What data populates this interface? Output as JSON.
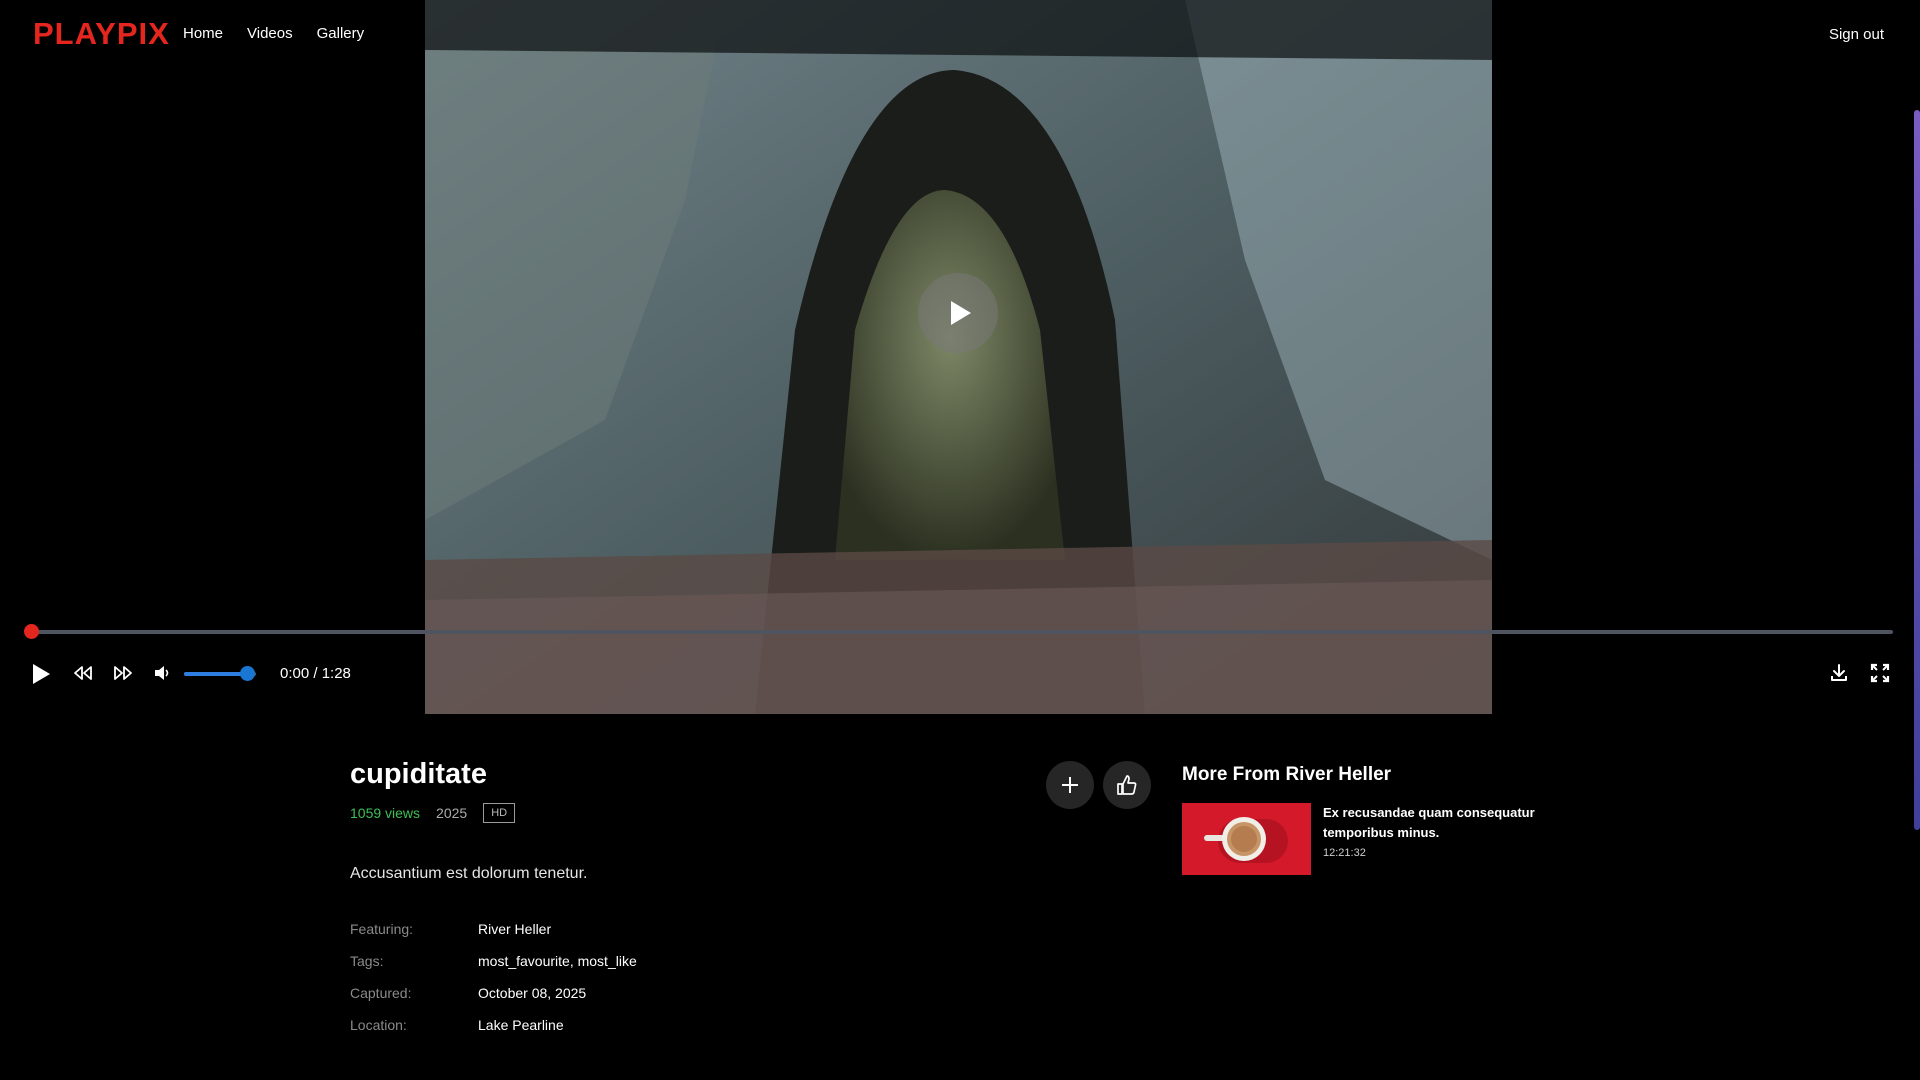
{
  "brand": {
    "logo": "PLAYPIX",
    "accent": "#e5261f"
  },
  "nav": {
    "links": [
      "Home",
      "Videos",
      "Gallery"
    ],
    "sign_out": "Sign out"
  },
  "player": {
    "time_display": "0:00 / 1:28",
    "progress_fraction": 0.0,
    "volume_fraction": 0.87,
    "icons": [
      "play-icon",
      "rewind-icon",
      "fast-forward-icon",
      "volume-icon",
      "download-icon",
      "fullscreen-icon"
    ]
  },
  "video": {
    "title": "cupiditate",
    "views": "1059 views",
    "year": "2025",
    "quality": "HD",
    "description": "Accusantium est dolorum tenetur.",
    "info": [
      {
        "key": "Featuring:",
        "value": "River Heller"
      },
      {
        "key": "Tags:",
        "value": "most_favourite, most_like"
      },
      {
        "key": "Captured:",
        "value": "October 08, 2025"
      },
      {
        "key": "Location:",
        "value": "Lake Pearline"
      }
    ]
  },
  "more_from": {
    "title": "More From River Heller",
    "items": [
      {
        "name": "Ex recusandae quam consequatur temporibus minus.",
        "duration": "12:21:32"
      }
    ]
  }
}
